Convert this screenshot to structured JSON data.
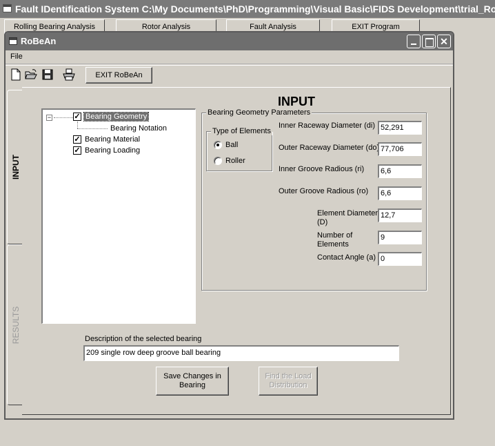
{
  "app": {
    "title": "Fault IDentification System   C:\\My Documents\\PhD\\Programming\\Visual Basic\\FIDS Development\\trial_Robean.rb",
    "buttons": [
      "Rolling Bearing Analysis",
      "Rotor Analysis",
      "Fault Analysis",
      "EXIT Program"
    ]
  },
  "window": {
    "title": "RoBeAn",
    "minimize_glyph": "",
    "maximize_glyph": "",
    "close_glyph": "✕"
  },
  "menu": {
    "file": "File"
  },
  "toolbar": {
    "new_glyph": "🗋",
    "open_glyph": "📂",
    "save_glyph": "💾",
    "print_glyph": "🖶",
    "exit_label": "EXIT RoBeAn"
  },
  "tabs": {
    "input": "INPUT",
    "results": "RESULTS"
  },
  "panel": {
    "heading": "INPUT"
  },
  "tree": {
    "expander_glyph": "−",
    "check_glyph": "✓",
    "items": [
      {
        "label": "Bearing Geometry",
        "checked": true
      },
      {
        "label": "Bearing Notation"
      },
      {
        "label": "Bearing Material",
        "checked": true
      },
      {
        "label": "Bearing Loading",
        "checked": true
      }
    ]
  },
  "geometry": {
    "legend": "Bearing Geometry Parameters",
    "elements": {
      "legend": "Type of Elements",
      "ball": "Ball",
      "roller": "Roller",
      "selected": "Ball"
    },
    "fields": {
      "di_label": "Inner Raceway Diameter (di)",
      "di_value": "52,291",
      "do_label": "Outer Raceway Diameter (do)",
      "do_value": "77,706",
      "ri_label": "Inner Groove Radious (ri)",
      "ri_value": "6,6",
      "ro_label": "Outer Groove Radious (ro)",
      "ro_value": "6,6",
      "D_label_1": "Element Diameter",
      "D_label_2": "(D)",
      "D_value": "12,7",
      "n_label_1": "Number of",
      "n_label_2": "Elements",
      "n_value": "9",
      "a_label": "Contact Angle (a)",
      "a_value": "0"
    }
  },
  "description": {
    "label": "Description of the selected bearing",
    "value": "209 single row deep groove ball bearing"
  },
  "buttons": {
    "save_1": "Save Changes in",
    "save_2": "Bearing",
    "load_1": "Find the Load",
    "load_2": "Distribution"
  }
}
